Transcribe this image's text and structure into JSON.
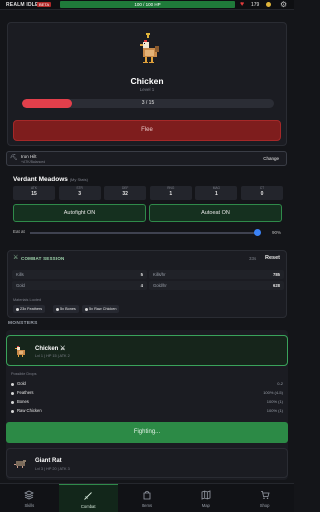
{
  "topbar": {
    "app_title": "REALM IDLE",
    "badge": "BETA",
    "hp_text": "100 / 100 HP",
    "hp_fraction": 1.0,
    "gold": "179",
    "colors": {
      "hp": "#1f7a3a",
      "badge": "#b02828"
    }
  },
  "enemy": {
    "name": "Chicken",
    "level": "Level 1",
    "hp_text": "3 / 15",
    "hp_fraction": 0.2,
    "flee_label": "Flee",
    "colors": {
      "hp": "#e23f4b",
      "flee": "#7e1d1d"
    }
  },
  "equipment": {
    "name": "Iron Hilt",
    "sub": "+ATK/Balanced",
    "change_label": "Change"
  },
  "location": {
    "title": "Verdant Meadows",
    "subtitle": "(My Stats)",
    "stats": [
      {
        "label": "ATK",
        "value": "15"
      },
      {
        "label": "STR",
        "value": "3"
      },
      {
        "label": "DEF",
        "value": "32"
      },
      {
        "label": "RNG",
        "value": "1"
      },
      {
        "label": "MAG",
        "value": "1"
      },
      {
        "label": "CT",
        "value": "0"
      }
    ],
    "autofight_label": "Autofight ON",
    "autoeat_label": "Autoeat ON",
    "eat_label": "Eat at",
    "eat_value": "90%",
    "eat_fraction": 0.9
  },
  "session": {
    "title": "COMBAT SESSION",
    "time": "33s",
    "reset_label": "Reset",
    "metrics": [
      {
        "label": "Kills",
        "value": "5"
      },
      {
        "label": "Kills/hr",
        "value": "785"
      },
      {
        "label": "Gold",
        "value": "4"
      },
      {
        "label": "Gold/hr",
        "value": "628"
      }
    ],
    "materials_label": "Materials Looted",
    "materials": [
      "23x Feathers",
      "5x Bones",
      "5x Raw Chicken"
    ]
  },
  "monsters": {
    "heading": "MONSTERS",
    "selected": {
      "name": "Chicken",
      "sub": "Lvl 1 | HP 15 | ATK 2"
    },
    "drops_label": "Possible Drops",
    "drops": [
      {
        "name": "Gold",
        "chance": "0-2"
      },
      {
        "name": "Feathers",
        "chance": "100% (4-5)"
      },
      {
        "name": "Bones",
        "chance": "100% (1)"
      },
      {
        "name": "Raw Chicken",
        "chance": "100% (1)"
      }
    ],
    "fighting_label": "Fighting...",
    "second": {
      "name": "Giant Rat",
      "sub": "Lvl 3 | HP 20 | ATK 3"
    }
  },
  "nav": {
    "items": [
      {
        "label": "Skills",
        "icon": "layers-icon"
      },
      {
        "label": "Combat",
        "icon": "sword-icon"
      },
      {
        "label": "Items",
        "icon": "bag-icon"
      },
      {
        "label": "Map",
        "icon": "map-icon"
      },
      {
        "label": "Shop",
        "icon": "cart-icon"
      }
    ],
    "active": "Combat"
  }
}
